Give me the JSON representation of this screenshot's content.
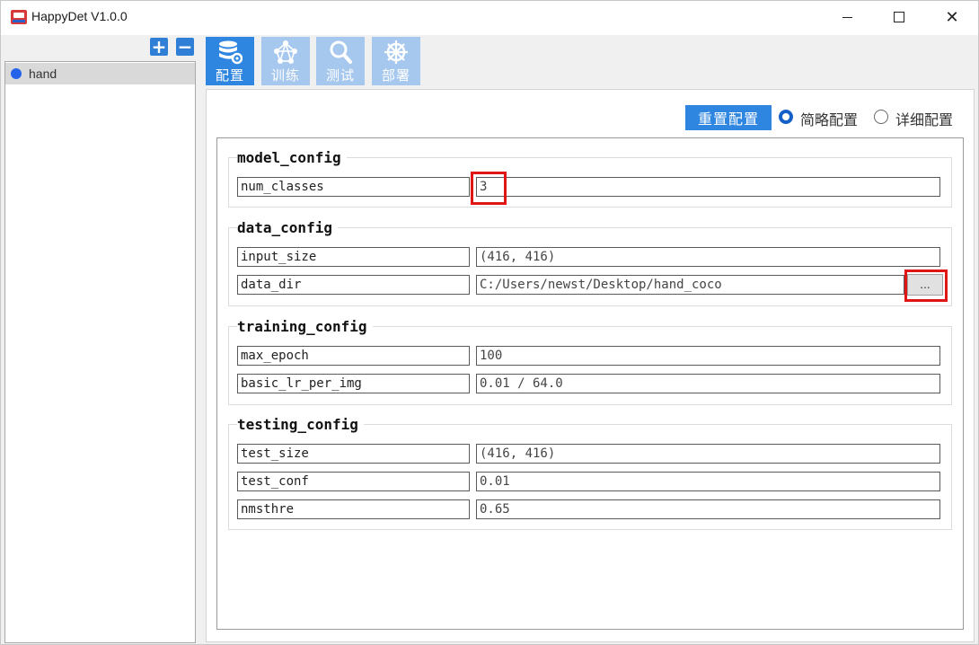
{
  "window": {
    "title": "HappyDet V1.0.0"
  },
  "sidebar": {
    "add_label": "+",
    "remove_label": "−",
    "items": [
      {
        "label": "hand"
      }
    ]
  },
  "toolbar": {
    "items": [
      {
        "label": "配置",
        "icon": "database-gear-icon",
        "active": true
      },
      {
        "label": "训练",
        "icon": "network-icon",
        "active": false
      },
      {
        "label": "测试",
        "icon": "magnifier-icon",
        "active": false
      },
      {
        "label": "部署",
        "icon": "helm-icon",
        "active": false
      }
    ]
  },
  "actions": {
    "reset_label": "重置配置",
    "mode_simple_label": "简略配置",
    "mode_detail_label": "详细配置",
    "selected_mode": "简略配置",
    "browse_label": "..."
  },
  "config": {
    "model_config": {
      "title": "model_config",
      "fields": [
        {
          "label": "num_classes",
          "value": "3"
        }
      ]
    },
    "data_config": {
      "title": "data_config",
      "fields": [
        {
          "label": "input_size",
          "value": "(416, 416)"
        },
        {
          "label": "data_dir",
          "value": "C:/Users/newst/Desktop/hand_coco"
        }
      ]
    },
    "training_config": {
      "title": "training_config",
      "fields": [
        {
          "label": "max_epoch",
          "value": "100"
        },
        {
          "label": "basic_lr_per_img",
          "value": "0.01 / 64.0"
        }
      ]
    },
    "testing_config": {
      "title": "testing_config",
      "fields": [
        {
          "label": "test_size",
          "value": "(416, 416)"
        },
        {
          "label": "test_conf",
          "value": "0.01"
        },
        {
          "label": "nmsthre",
          "value": "0.65"
        }
      ]
    }
  },
  "colors": {
    "accent": "#2f86e0",
    "accent_inactive": "#a7c8ee",
    "highlight": "#e01616"
  }
}
